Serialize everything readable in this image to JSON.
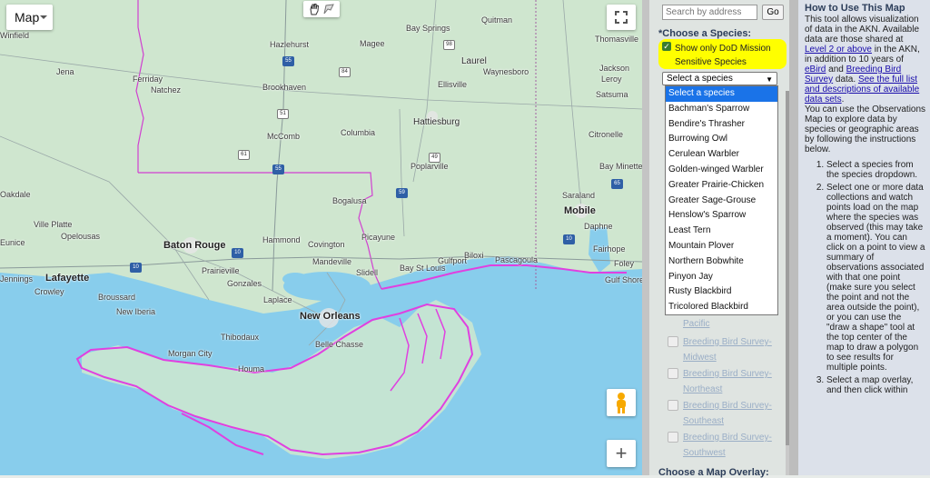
{
  "map": {
    "type_button": "Map",
    "zoom_in_label": "+",
    "labels": {
      "winfield": "Winfield",
      "jena": "Jena",
      "ferriday": "Ferriday",
      "natchez": "Natchez",
      "hazlehurst": "Hazlehurst",
      "magee": "Magee",
      "bay_springs": "Bay Springs",
      "quitman": "Quitman",
      "laurel": "Laurel",
      "brookhaven": "Brookhaven",
      "waynesboro": "Waynesboro",
      "ellisville": "Ellisville",
      "hattiesburg": "Hattiesburg",
      "mccomb": "McComb",
      "columbia": "Columbia",
      "thomasville": "Thomasville",
      "jackson": "Jackson",
      "leroy": "Leroy",
      "citronelle": "Citronelle",
      "satsuma": "Satsuma",
      "bay_minette": "Bay Minette",
      "saraland": "Saraland",
      "mobile": "Mobile",
      "daphne": "Daphne",
      "fairhope": "Fairhope",
      "foley": "Foley",
      "gulf_shores": "Gulf Shores",
      "bogalusa": "Bogalusa",
      "picayune": "Picayune",
      "poplarville": "Poplarville",
      "pascagoula": "Pascagoula",
      "gulfport": "Gulfport",
      "biloxi": "Biloxi",
      "bay_st_louis": "Bay St Louis",
      "slidell": "Slidell",
      "covington": "Covington",
      "mandeville": "Mandeville",
      "hammond": "Hammond",
      "baton_rouge": "Baton Rouge",
      "oakdale": "Oakdale",
      "ville_platte": "Ville Platte",
      "opelousas": "Opelousas",
      "eunice": "Eunice",
      "lafayette": "Lafayette",
      "crowley": "Crowley",
      "prairieville": "Prairieville",
      "gonzales": "Gonzales",
      "laplace": "Laplace",
      "broussard": "Broussard",
      "new_iberia": "New Iberia",
      "new_orleans": "New Orleans",
      "thibodaux": "Thibodaux",
      "belle_chasse": "Belle Chasse",
      "morgan_city": "Morgan City",
      "houma": "Houma",
      "jennings": "Jennings"
    },
    "shields": {
      "s55a": "55",
      "s55b": "55",
      "s10a": "10",
      "s10b": "10",
      "s10c": "10",
      "s49": "49",
      "s59": "59",
      "s65": "65",
      "s61": "61",
      "s84": "84",
      "s98": "98",
      "s51": "51"
    }
  },
  "search": {
    "placeholder": "Search by address",
    "go_label": "Go"
  },
  "species": {
    "heading": "*Choose a Species:",
    "dod_label": "Show only DoD Mission Sensitive Species",
    "dod_checked": true,
    "selected": "Select a species",
    "options": [
      "Select a species",
      "Bachman's Sparrow",
      "Bendire's Thrasher",
      "Burrowing Owl",
      "Cerulean Warbler",
      "Golden-winged Warbler",
      "Greater Prairie-Chicken",
      "Greater Sage-Grouse",
      "Henslow's Sparrow",
      "Least Tern",
      "Mountain Plover",
      "Northern Bobwhite",
      "Pinyon Jay",
      "Rusty Blackbird",
      "Tricolored Blackbird"
    ]
  },
  "collections": [
    "Pacific",
    "Breeding Bird Survey-Midwest",
    "Breeding Bird Survey-Northeast",
    "Breeding Bird Survey-Southeast",
    "Breeding Bird Survey-Southwest"
  ],
  "overlay_heading": "Choose a Map Overlay:",
  "howto": {
    "title": "How to Use This Map",
    "p1_a": "This tool allows visualization of data in the AKN. Available data are those shared at ",
    "link_level": "Level 2 or above",
    "p1_b": " in the AKN, in addition to 10 years of ",
    "link_ebird": "eBird",
    "p1_c": " and ",
    "link_bbs": "Breeding Bird Survey",
    "p1_d": " data. ",
    "link_list": "See the full list and descriptions of available data sets",
    "p1_e": ".",
    "p2": "You can use the Observations Map to explore data by species or geographic areas by following the instructions below.",
    "steps": [
      "Select a species from the species dropdown.",
      "Select one or more data collections and watch points load on the map where the species was observed (this may take a moment). You can click on a point to view a summary of observations associated with that one point (make sure you select the point and not the area outside the point), or you can use the \"draw a shape\" tool at the top center of the map to draw a polygon to see results for multiple points.",
      "Select a map overlay, and then click within"
    ]
  }
}
